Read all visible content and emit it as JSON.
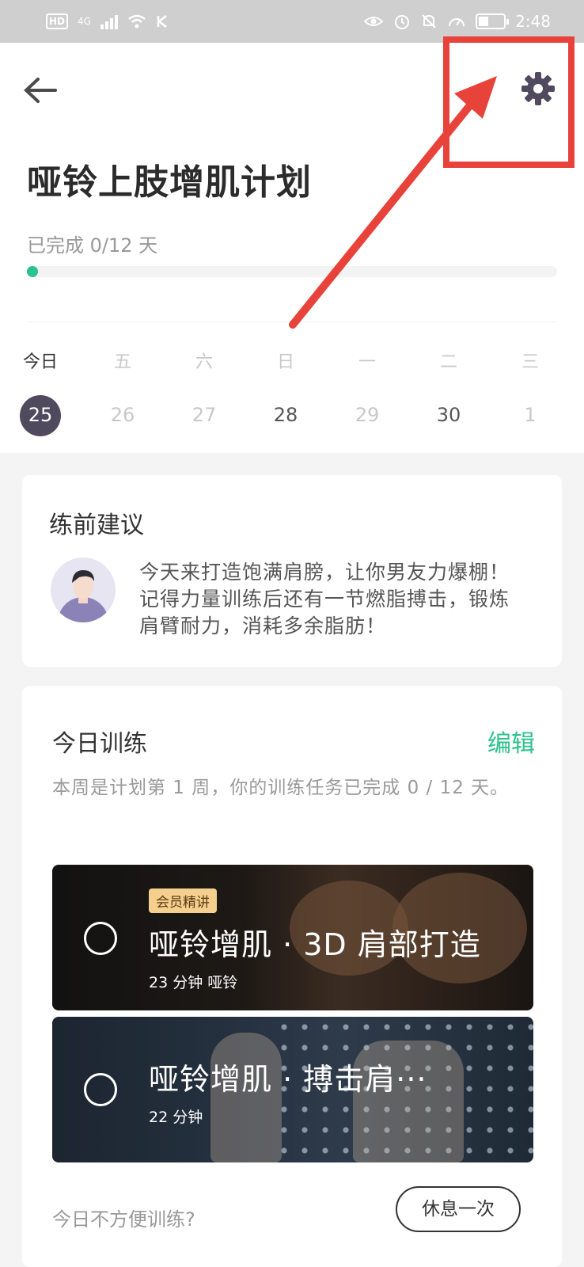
{
  "status_bar": {
    "hd": "HD",
    "network": "4G",
    "time": "2:48"
  },
  "plan": {
    "title": "哑铃上肢增肌计划",
    "progress_text": "已完成 0/12 天",
    "progress_fraction": 0.0
  },
  "week": {
    "labels": [
      "今日",
      "五",
      "六",
      "日",
      "一",
      "二",
      "三"
    ],
    "dates": [
      "25",
      "26",
      "27",
      "28",
      "29",
      "30",
      "1"
    ],
    "selected_index": 0
  },
  "advice": {
    "title": "练前建议",
    "text": "今天来打造饱满肩膀，让你男友力爆棚！记得力量训练后还有一节燃脂搏击，锻炼肩臂耐力，消耗多余脂肪！"
  },
  "training": {
    "title": "今日训练",
    "edit_label": "编辑",
    "description": "本周是计划第 1 周，你的训练任务已完成 0 / 12 天。",
    "sessions": [
      {
        "badge": "会员精讲",
        "name": "哑铃增肌 · 3D 肩部打造",
        "meta": "23 分钟 哑铃"
      },
      {
        "name": "哑铃增肌 · 搏击肩···",
        "meta": "22 分钟"
      }
    ],
    "rest_question": "今日不方便训练?",
    "rest_button": "休息一次"
  },
  "colors": {
    "accent_green": "#2bc28c",
    "selected_date_bg": "#4f4a5e",
    "annotation_red": "#e8433a",
    "badge_gold": "#f5cf8e"
  },
  "icons": {
    "back": "arrow-left-icon",
    "settings": "gear-icon",
    "avatar": "user-avatar-icon",
    "check": "circle-outline-icon"
  }
}
